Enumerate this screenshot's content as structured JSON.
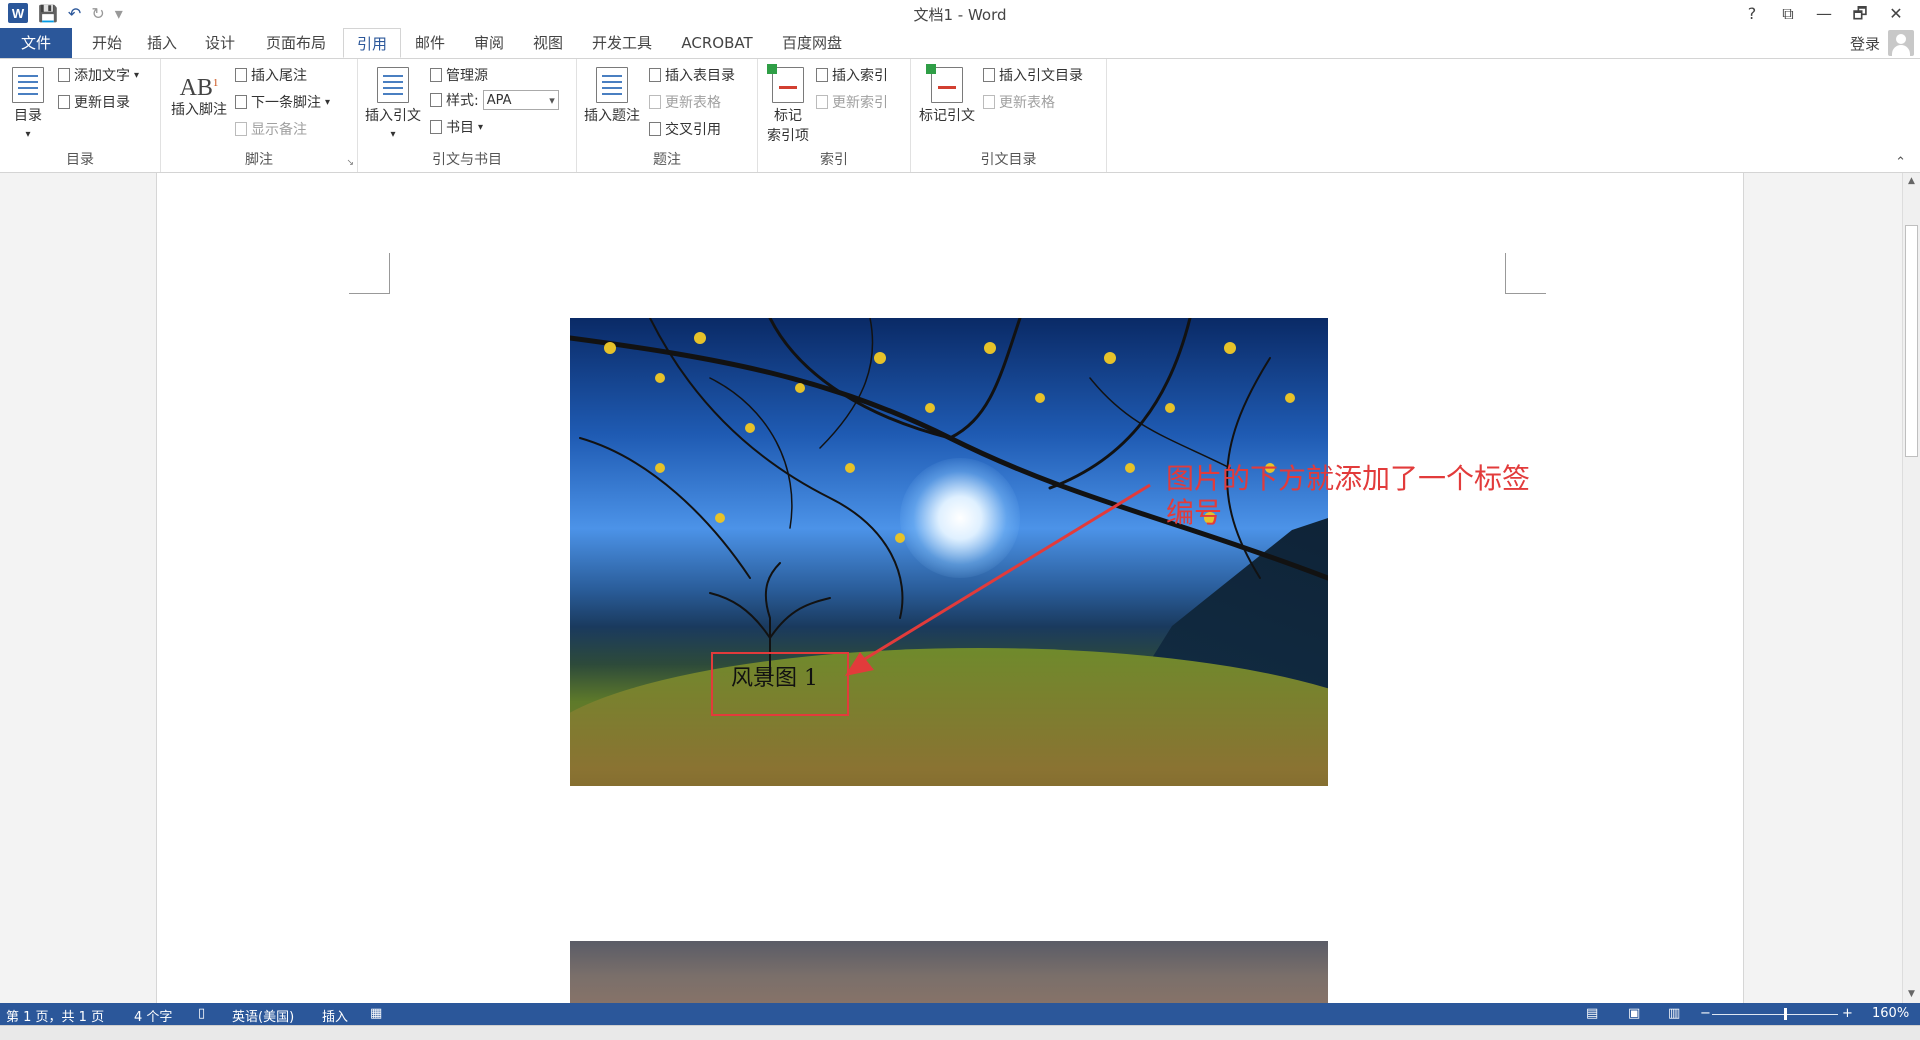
{
  "title": "文档1 - Word",
  "window_controls": [
    "?",
    "⧉",
    "—",
    "🗗",
    "✕"
  ],
  "qat": {
    "save": "💾",
    "undo": "↶",
    "redo": "↻",
    "more": "▾"
  },
  "tabs": [
    "文件",
    "开始",
    "插入",
    "设计",
    "页面布局",
    "引用",
    "邮件",
    "审阅",
    "视图",
    "开发工具",
    "ACROBAT",
    "百度网盘"
  ],
  "active_tab": "引用",
  "login": "登录",
  "ribbon": {
    "toc": {
      "big": "目录",
      "add_text": "添加文字",
      "update_toc": "更新目录",
      "label": "目录"
    },
    "footnote": {
      "big": "插入脚注",
      "ab": "AB",
      "sup": "1",
      "insert_endnote": "插入尾注",
      "next_footnote": "下一条脚注",
      "show_notes": "显示备注",
      "label": "脚注"
    },
    "citation": {
      "big": "插入引文",
      "manage_sources": "管理源",
      "style_label": "样式:",
      "style_value": "APA",
      "bibliography": "书目",
      "label": "引文与书目"
    },
    "caption": {
      "big": "插入题注",
      "insert_table_of_figures": "插入表目录",
      "update_table": "更新表格",
      "cross_reference": "交叉引用",
      "label": "题注"
    },
    "index": {
      "big_line1": "标记",
      "big_line2": "索引项",
      "insert_index": "插入索引",
      "update_index": "更新索引",
      "label": "索引"
    },
    "toa": {
      "big": "标记引文",
      "insert_toa": "插入引文目录",
      "update_table": "更新表格",
      "label": "引文目录"
    }
  },
  "document": {
    "caption_text": "风景图 1",
    "annotation": "图片的下方就添加了一个标签编号"
  },
  "status_bar": {
    "page": "第 1 页，共 1 页",
    "words": "4 个字",
    "language": "英语(美国)",
    "mode": "插入",
    "zoom": "160%"
  },
  "colors": {
    "accent": "#2b579a",
    "annotation": "#e23b3b"
  }
}
